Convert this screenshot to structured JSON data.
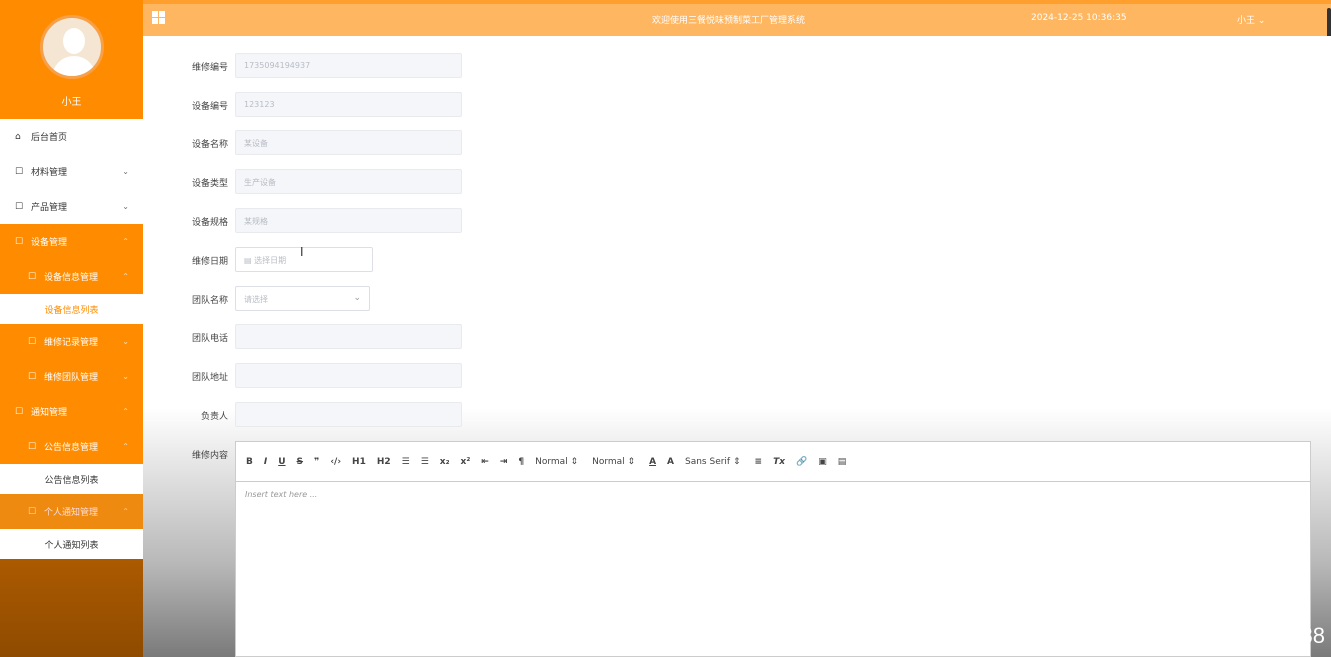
{
  "sidebar": {
    "username": "小王",
    "items": [
      {
        "label": "后台首页",
        "icon": "home-icon"
      },
      {
        "label": "材料管理",
        "icon": "edit-icon"
      },
      {
        "label": "产品管理",
        "icon": "edit-icon"
      },
      {
        "label": "设备管理",
        "icon": "edit-icon"
      },
      {
        "label": "设备信息管理",
        "icon": "edit-icon"
      },
      {
        "label": "设备信息列表"
      },
      {
        "label": "维修记录管理",
        "icon": "edit-icon"
      },
      {
        "label": "维修团队管理",
        "icon": "edit-icon"
      },
      {
        "label": "通知管理",
        "icon": "edit-icon"
      },
      {
        "label": "公告信息管理",
        "icon": "edit-icon"
      },
      {
        "label": "公告信息列表"
      },
      {
        "label": "个人通知管理",
        "icon": "edit-icon"
      },
      {
        "label": "个人通知列表"
      }
    ]
  },
  "header": {
    "title": "欢迎使用三餐悦味预制菜工厂管理系统",
    "datetime": "2024-12-25 10:36:35",
    "user": "小王 ⌄"
  },
  "form": {
    "fields": [
      {
        "label": "维修编号",
        "value": "1735094194937"
      },
      {
        "label": "设备编号",
        "value": "123123"
      },
      {
        "label": "设备名称",
        "value": "某设备"
      },
      {
        "label": "设备类型",
        "value": "生产设备"
      },
      {
        "label": "设备规格",
        "value": "某规格"
      },
      {
        "label": "维修日期",
        "placeholder": "选择日期"
      },
      {
        "label": "团队名称",
        "placeholder": "请选择"
      },
      {
        "label": "团队电话",
        "value": ""
      },
      {
        "label": "团队地址",
        "value": ""
      },
      {
        "label": "负责人",
        "value": ""
      }
    ],
    "editor_label": "维修内容",
    "editor_placeholder": "Insert text here ...",
    "toolbar": {
      "bold": "B",
      "italic": "I",
      "underline": "U",
      "strike": "S",
      "quote": "❞",
      "code": "‹/›",
      "h1": "H1",
      "h2": "H2",
      "ol": "☰",
      "ul": "☰",
      "sub": "x₂",
      "sup": "x²",
      "outdent": "⇤",
      "indent": "⇥",
      "direction": "¶",
      "size1": "Normal ⇕",
      "size2": "Normal ⇕",
      "color": "A",
      "bg": "A",
      "font": "Sans Serif ⇕",
      "align": "≡",
      "clean": "Tx",
      "link": "🔗",
      "image": "▣",
      "video": "▤"
    }
  },
  "watermark": "CSDN @vx_CXKF10088"
}
